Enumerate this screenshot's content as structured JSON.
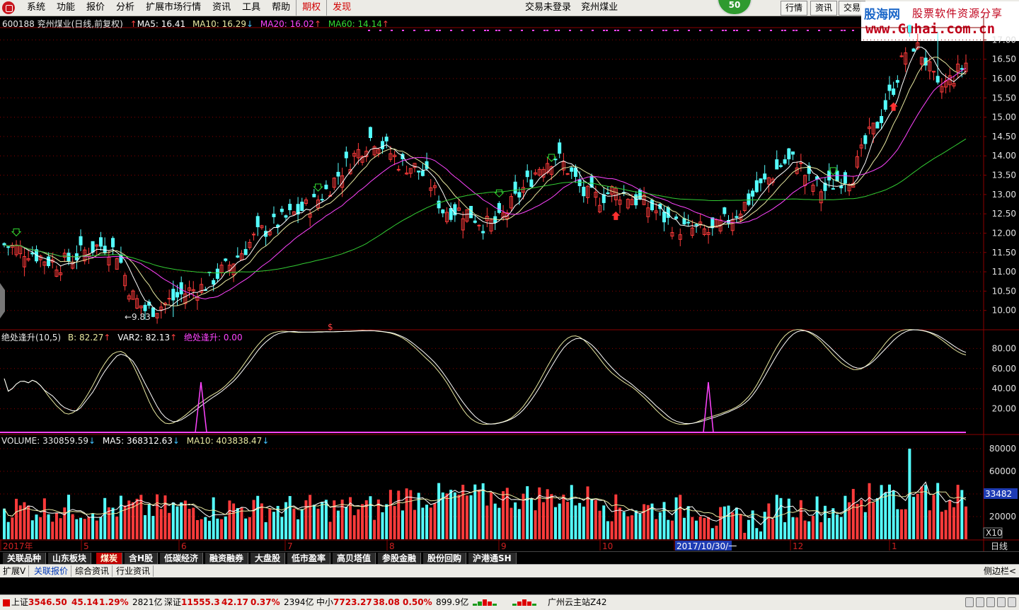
{
  "menu": {
    "items": [
      "系统",
      "功能",
      "报价",
      "分析",
      "扩展市场行情",
      "资讯",
      "工具",
      "帮助"
    ],
    "red_items": [
      "期权",
      "发现"
    ],
    "center": [
      "交易未登录",
      "兖州煤业"
    ],
    "badge": "50",
    "buttons": [
      "行情",
      "资讯",
      "交易"
    ]
  },
  "watermark": {
    "brand": "股海网",
    "tagline": "股票软件资源分享",
    "url": "www.Guhai.com.cn"
  },
  "stock_header": {
    "code_name": "600188 兖州煤业(日线,前复权)",
    "ma5": "MA5: 16.41",
    "ma10": "MA10: 16.29",
    "ma20": "MA20: 16.02",
    "ma60": "MA60: 14.14",
    "up": "↑",
    "down": "↓"
  },
  "indicator_header": {
    "name": "绝处逢升(10,5)",
    "b": "B: 82.27",
    "var2": "VAR2: 82.13",
    "signal": "绝处逢升: 0.00"
  },
  "volume_header": {
    "volume": "VOLUME: 330859.59",
    "ma5": "MA5: 368312.63",
    "ma10": "MA10: 403838.47"
  },
  "price_axis": [
    "17.00",
    "16.50",
    "16.00",
    "15.50",
    "15.00",
    "14.50",
    "14.00",
    "13.50",
    "13.00",
    "12.50",
    "12.00",
    "11.50",
    "11.00",
    "10.50",
    "10.00"
  ],
  "ind_axis": [
    "80.00",
    "60.00",
    "40.00",
    "20.00"
  ],
  "vol_axis": [
    "80000",
    "60000",
    "40000",
    "20000"
  ],
  "vol_current": "33482",
  "vol_unit": "X10",
  "low_label": "9.83",
  "marker_s": "$",
  "time_axis": [
    "2017年",
    "5",
    "6",
    "7",
    "8",
    "9",
    "10",
    "2017/10/30/一",
    "12",
    "1"
  ],
  "period": "日线",
  "sector_tabs": [
    "关联品种",
    "山东板块",
    "煤炭",
    "含H股",
    "低碳经济",
    "融资融券",
    "大盘股",
    "低市盈率",
    "高贝塔值",
    "参股金融",
    "股份回购",
    "沪港通SH"
  ],
  "sector_active": 2,
  "sub_tabs": [
    "扩展V",
    "关联报价",
    "综合资讯",
    "行业资讯"
  ],
  "sub_active": 1,
  "side_bar": "侧边栏<",
  "status": {
    "sh_label": "上证",
    "sh_val": "3546.50",
    "sh_chg": "45.14",
    "sh_pct": "1.29%",
    "sh_amt": "2821亿",
    "sz_label": "深证",
    "sz_val": "11555.3",
    "sz_chg": "42.17",
    "sz_pct": "0.37%",
    "sz_amt": "2394亿",
    "zx_label": "中小",
    "zx_val": "7723.27",
    "zx_chg": "38.08",
    "zx_pct": "0.50%",
    "zx_amt": "899.9亿",
    "server": "广州云主站Z42"
  },
  "colors": {
    "up": "#ff3b3b",
    "down": "#54ffff",
    "ma5": "#ffffff",
    "ma10": "#e8e8a0",
    "ma20": "#ff44ff",
    "ma60": "#33cc33",
    "grid": "#8b0000"
  },
  "chart_data": {
    "type": "candlestick",
    "price_range": [
      9.5,
      17.3
    ],
    "visible_stats": {
      "low": 9.83
    },
    "close_trend": [
      11.7,
      11.6,
      11.5,
      11.3,
      11.2,
      11.4,
      11.6,
      11.7,
      11.5,
      10.4,
      10.0,
      10.1,
      10.3,
      10.5,
      10.6,
      10.9,
      11.2,
      11.6,
      12.0,
      12.2,
      12.4,
      12.6,
      12.8,
      13.2,
      13.7,
      14.1,
      14.5,
      14.2,
      13.8,
      13.7,
      13.4,
      12.6,
      12.6,
      12.5,
      12.2,
      12.3,
      12.8,
      13.3,
      13.8,
      14.0,
      13.6,
      13.0,
      12.9,
      13.1,
      13.0,
      12.8,
      12.6,
      12.3,
      12.1,
      12.1,
      12.0,
      12.3,
      12.6,
      13.0,
      13.4,
      13.8,
      13.9,
      13.3,
      13.1,
      13.4,
      13.5,
      14.4,
      15.0,
      15.9,
      17.0,
      16.6,
      15.7,
      16.0,
      16.4
    ],
    "ma_periods": [
      5,
      10,
      20,
      60
    ]
  }
}
